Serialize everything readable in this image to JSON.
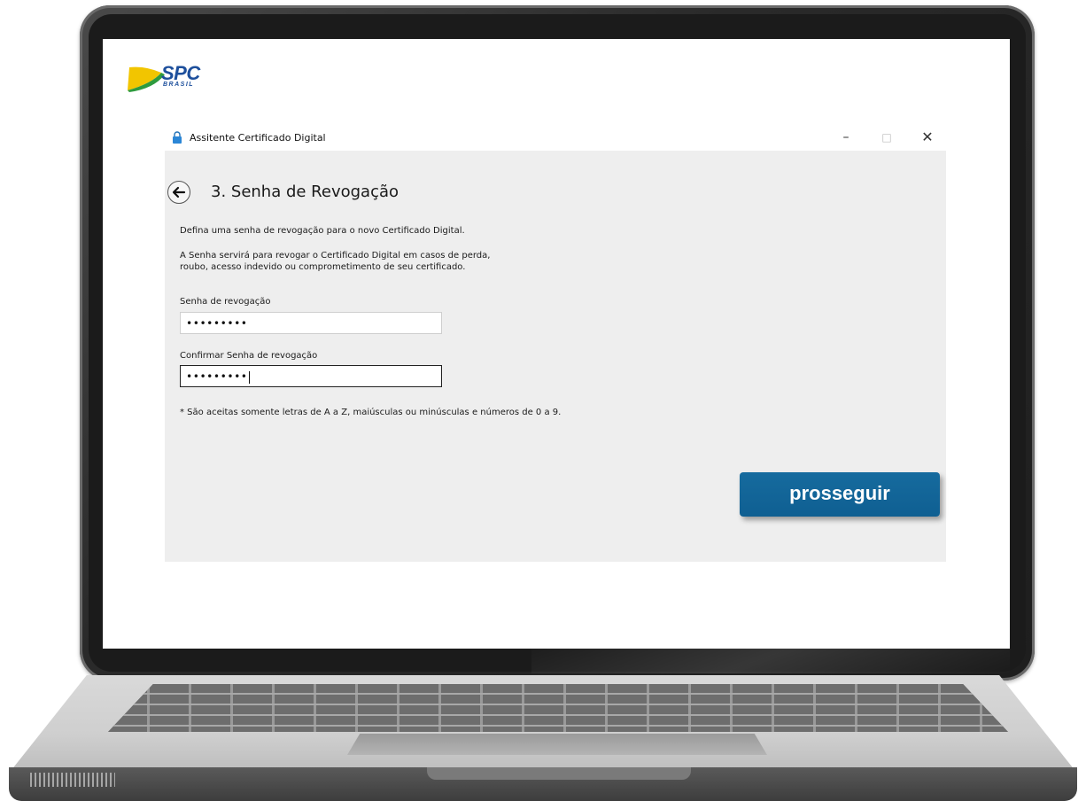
{
  "brand": {
    "logo_text": "SPC",
    "logo_subtext": "BRASIL"
  },
  "window": {
    "title": "Assitente Certificado Digital",
    "controls": {
      "minimize": "–",
      "maximize": "□",
      "close": "✕"
    }
  },
  "step": {
    "title": "3. Senha de Revogação",
    "intro": "Defina uma senha de revogação para o novo Certificado Digital.",
    "desc_line1": "A Senha servirá para revogar o Certificado Digital em casos de perda,",
    "desc_line2": "roubo, acesso indevido ou comprometimento de seu certificado.",
    "field1": {
      "label": "Senha de revogação",
      "value": "•••••••••"
    },
    "field2": {
      "label": "Confirmar Senha de revogação",
      "value": "•••••••••"
    },
    "note": "* São aceitas somente letras de A a Z, maiúsculas ou minúsculas e números de 0 a 9.",
    "next_label": "prosseguir"
  },
  "colors": {
    "accent": "#0f5f92",
    "logo_blue": "#1d4f9c",
    "logo_yellow": "#f2c500",
    "content_bg": "#eeeeee"
  },
  "icons": {
    "back": "arrow-left-icon",
    "window": "lock-icon"
  }
}
